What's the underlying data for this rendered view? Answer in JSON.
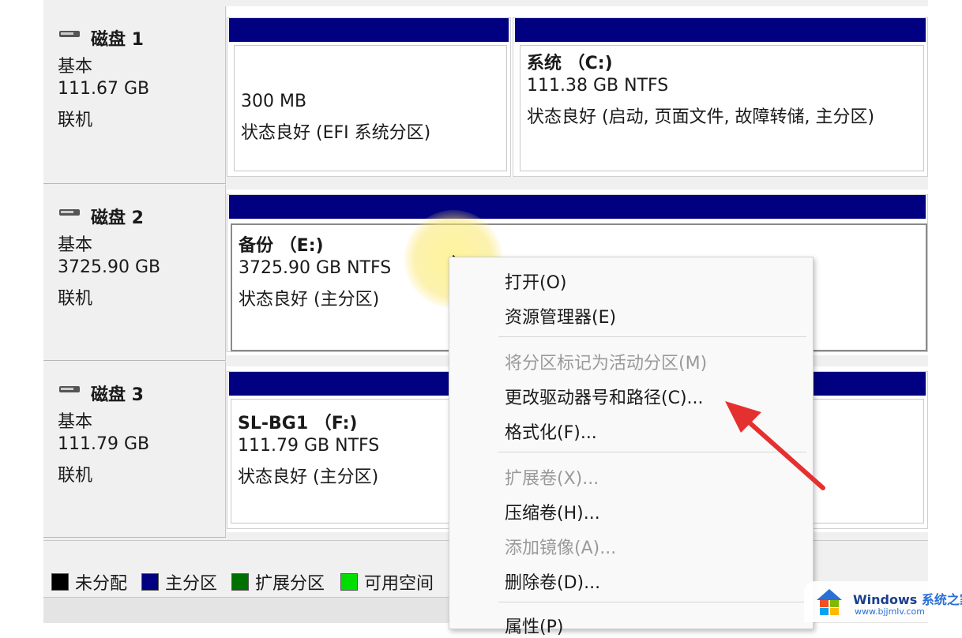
{
  "disks": [
    {
      "name": "磁盘 1",
      "type": "基本",
      "size": "111.67 GB",
      "status": "联机"
    },
    {
      "name": "磁盘 2",
      "type": "基本",
      "size": "3725.90 GB",
      "status": "联机"
    },
    {
      "name": "磁盘 3",
      "type": "基本",
      "size": "111.79 GB",
      "status": "联机"
    }
  ],
  "volumes": {
    "disk1_efi": {
      "size": "300 MB",
      "status": "状态良好 (EFI 系统分区)"
    },
    "disk1_c": {
      "name": "系统 （C:)",
      "size": "111.38 GB NTFS",
      "status": "状态良好 (启动, 页面文件, 故障转储, 主分区)"
    },
    "disk2_e": {
      "name": "备份 （E:)",
      "size": "3725.90 GB NTFS",
      "status": "状态良好 (主分区)"
    },
    "disk3_f": {
      "name": "SL-BG1 （F:)",
      "size": "111.79 GB NTFS",
      "status": "状态良好 (主分区)"
    }
  },
  "legend": [
    {
      "label": "未分配",
      "color": "#000000"
    },
    {
      "label": "主分区",
      "color": "#000080"
    },
    {
      "label": "扩展分区",
      "color": "#007000"
    },
    {
      "label": "可用空间",
      "color": "#00dd00"
    }
  ],
  "context_menu": {
    "items": [
      {
        "label": "打开(O)",
        "enabled": true
      },
      {
        "label": "资源管理器(E)",
        "enabled": true
      },
      {
        "label": "将分区标记为活动分区(M)",
        "enabled": false
      },
      {
        "label": "更改驱动器号和路径(C)...",
        "enabled": true
      },
      {
        "label": "格式化(F)...",
        "enabled": true
      },
      {
        "label": "扩展卷(X)...",
        "enabled": false
      },
      {
        "label": "压缩卷(H)...",
        "enabled": true
      },
      {
        "label": "添加镜像(A)...",
        "enabled": false
      },
      {
        "label": "删除卷(D)...",
        "enabled": true
      },
      {
        "label": "属性(P)",
        "enabled": true
      }
    ]
  },
  "watermark": {
    "brand": "Windows",
    "brand_suffix": "系统之家",
    "url": "www.bjjmlv.com"
  },
  "colors": {
    "primary_partition": "#000080",
    "arrow": "#e53030",
    "highlight": "#f5e36e"
  }
}
